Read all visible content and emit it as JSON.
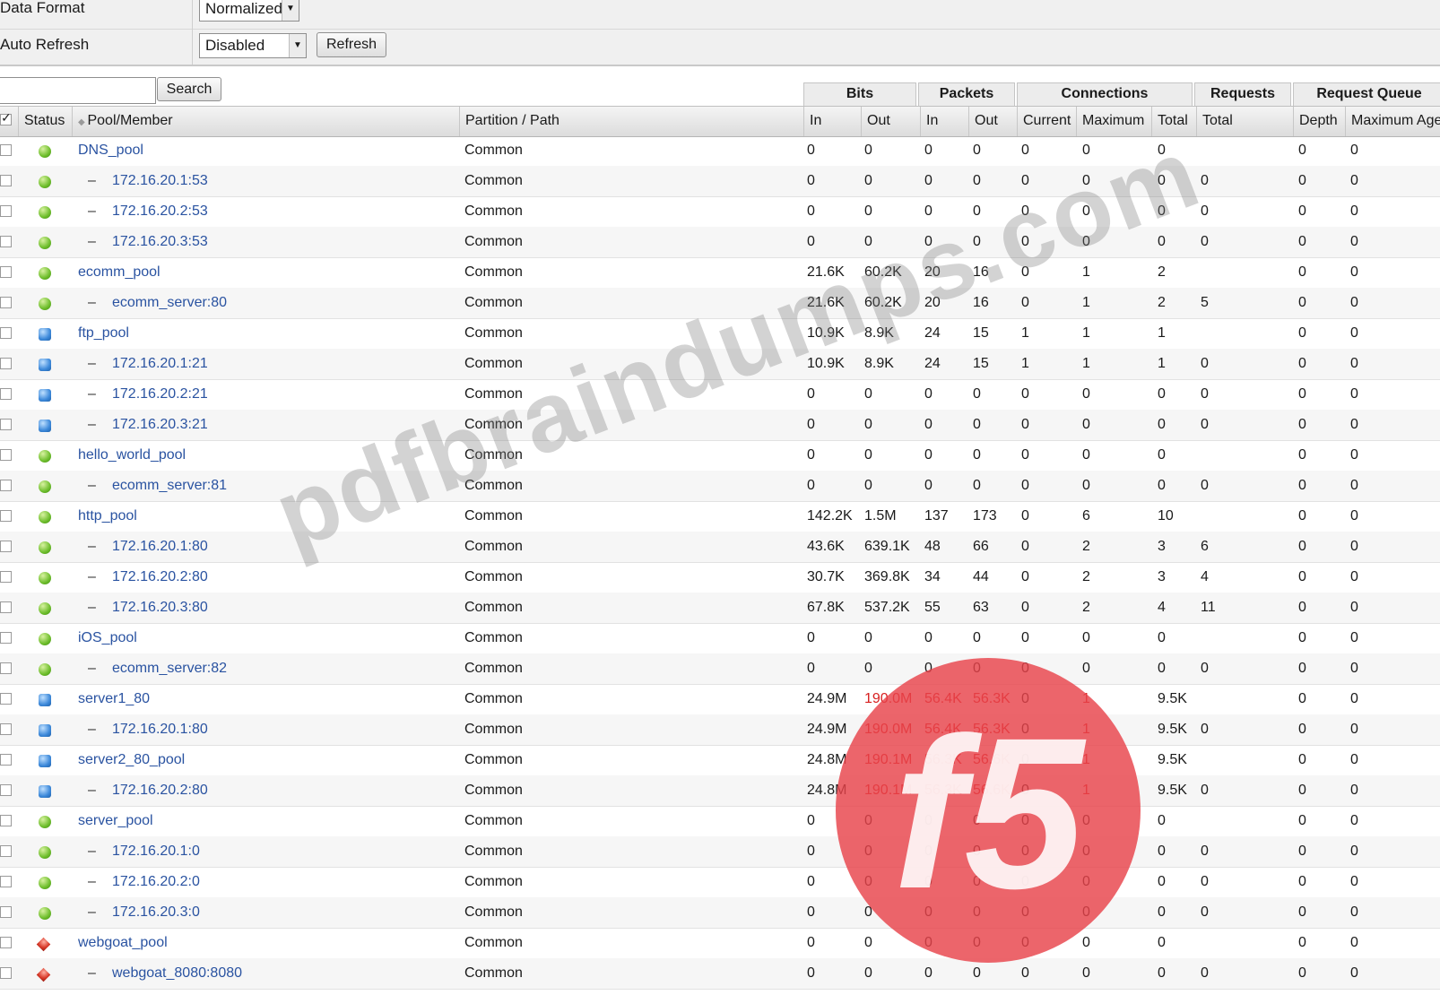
{
  "settings": {
    "data_format_label": "Data Format",
    "data_format_value": "Normalized",
    "auto_refresh_label": "Auto Refresh",
    "auto_refresh_value": "Disabled",
    "refresh_button": "Refresh"
  },
  "search": {
    "button": "Search",
    "value": ""
  },
  "groups": {
    "bits": "Bits",
    "packets": "Packets",
    "connections": "Connections",
    "requests": "Requests",
    "request_queue": "Request Queue"
  },
  "columns": {
    "status": "Status",
    "pool_member": "Pool/Member",
    "partition": "Partition / Path",
    "bits_in": "In",
    "bits_out": "Out",
    "pkts_in": "In",
    "pkts_out": "Out",
    "conn_current": "Current",
    "conn_max": "Maximum",
    "conn_total": "Total",
    "req_total": "Total",
    "rq_depth": "Depth",
    "rq_max_age": "Maximum Age"
  },
  "rows": [
    {
      "name": "DNS_pool",
      "member": false,
      "status": "green",
      "partition": "Common",
      "bin": "0",
      "bout": "0",
      "pin": "0",
      "pout": "0",
      "cur": "0",
      "max": "0",
      "total": "0",
      "req": "",
      "depth": "0",
      "age": "0"
    },
    {
      "name": "172.16.20.1:53",
      "member": true,
      "status": "green",
      "partition": "Common",
      "bin": "0",
      "bout": "0",
      "pin": "0",
      "pout": "0",
      "cur": "0",
      "max": "0",
      "total": "0",
      "req": "0",
      "depth": "0",
      "age": "0"
    },
    {
      "name": "172.16.20.2:53",
      "member": true,
      "status": "green",
      "partition": "Common",
      "bin": "0",
      "bout": "0",
      "pin": "0",
      "pout": "0",
      "cur": "0",
      "max": "0",
      "total": "0",
      "req": "0",
      "depth": "0",
      "age": "0"
    },
    {
      "name": "172.16.20.3:53",
      "member": true,
      "status": "green",
      "partition": "Common",
      "bin": "0",
      "bout": "0",
      "pin": "0",
      "pout": "0",
      "cur": "0",
      "max": "0",
      "total": "0",
      "req": "0",
      "depth": "0",
      "age": "0"
    },
    {
      "name": "ecomm_pool",
      "member": false,
      "status": "green",
      "partition": "Common",
      "bin": "21.6K",
      "bout": "60.2K",
      "pin": "20",
      "pout": "16",
      "cur": "0",
      "max": "1",
      "total": "2",
      "req": "",
      "depth": "0",
      "age": "0"
    },
    {
      "name": "ecomm_server:80",
      "member": true,
      "status": "green",
      "partition": "Common",
      "bin": "21.6K",
      "bout": "60.2K",
      "pin": "20",
      "pout": "16",
      "cur": "0",
      "max": "1",
      "total": "2",
      "req": "5",
      "depth": "0",
      "age": "0"
    },
    {
      "name": "ftp_pool",
      "member": false,
      "status": "blue",
      "partition": "Common",
      "bin": "10.9K",
      "bout": "8.9K",
      "pin": "24",
      "pout": "15",
      "cur": "1",
      "max": "1",
      "total": "1",
      "req": "",
      "depth": "0",
      "age": "0"
    },
    {
      "name": "172.16.20.1:21",
      "member": true,
      "status": "blue",
      "partition": "Common",
      "bin": "10.9K",
      "bout": "8.9K",
      "pin": "24",
      "pout": "15",
      "cur": "1",
      "max": "1",
      "total": "1",
      "req": "0",
      "depth": "0",
      "age": "0"
    },
    {
      "name": "172.16.20.2:21",
      "member": true,
      "status": "blue",
      "partition": "Common",
      "bin": "0",
      "bout": "0",
      "pin": "0",
      "pout": "0",
      "cur": "0",
      "max": "0",
      "total": "0",
      "req": "0",
      "depth": "0",
      "age": "0"
    },
    {
      "name": "172.16.20.3:21",
      "member": true,
      "status": "blue",
      "partition": "Common",
      "bin": "0",
      "bout": "0",
      "pin": "0",
      "pout": "0",
      "cur": "0",
      "max": "0",
      "total": "0",
      "req": "0",
      "depth": "0",
      "age": "0"
    },
    {
      "name": "hello_world_pool",
      "member": false,
      "status": "green",
      "partition": "Common",
      "bin": "0",
      "bout": "0",
      "pin": "0",
      "pout": "0",
      "cur": "0",
      "max": "0",
      "total": "0",
      "req": "",
      "depth": "0",
      "age": "0"
    },
    {
      "name": "ecomm_server:81",
      "member": true,
      "status": "green",
      "partition": "Common",
      "bin": "0",
      "bout": "0",
      "pin": "0",
      "pout": "0",
      "cur": "0",
      "max": "0",
      "total": "0",
      "req": "0",
      "depth": "0",
      "age": "0"
    },
    {
      "name": "http_pool",
      "member": false,
      "status": "green",
      "partition": "Common",
      "bin": "142.2K",
      "bout": "1.5M",
      "pin": "137",
      "pout": "173",
      "cur": "0",
      "max": "6",
      "total": "10",
      "req": "",
      "depth": "0",
      "age": "0"
    },
    {
      "name": "172.16.20.1:80",
      "member": true,
      "status": "green",
      "partition": "Common",
      "bin": "43.6K",
      "bout": "639.1K",
      "pin": "48",
      "pout": "66",
      "cur": "0",
      "max": "2",
      "total": "3",
      "req": "6",
      "depth": "0",
      "age": "0"
    },
    {
      "name": "172.16.20.2:80",
      "member": true,
      "status": "green",
      "partition": "Common",
      "bin": "30.7K",
      "bout": "369.8K",
      "pin": "34",
      "pout": "44",
      "cur": "0",
      "max": "2",
      "total": "3",
      "req": "4",
      "depth": "0",
      "age": "0"
    },
    {
      "name": "172.16.20.3:80",
      "member": true,
      "status": "green",
      "partition": "Common",
      "bin": "67.8K",
      "bout": "537.2K",
      "pin": "55",
      "pout": "63",
      "cur": "0",
      "max": "2",
      "total": "4",
      "req": "11",
      "depth": "0",
      "age": "0"
    },
    {
      "name": "iOS_pool",
      "member": false,
      "status": "green",
      "partition": "Common",
      "bin": "0",
      "bout": "0",
      "pin": "0",
      "pout": "0",
      "cur": "0",
      "max": "0",
      "total": "0",
      "req": "",
      "depth": "0",
      "age": "0"
    },
    {
      "name": "ecomm_server:82",
      "member": true,
      "status": "green",
      "partition": "Common",
      "bin": "0",
      "bout": "0",
      "pin": "0",
      "pout": "0",
      "cur": "0",
      "max": "0",
      "total": "0",
      "req": "0",
      "depth": "0",
      "age": "0"
    },
    {
      "name": "server1_80",
      "member": false,
      "status": "blue",
      "partition": "Common",
      "bin": "24.9M",
      "bout": "190.0M",
      "pin": "56.4K",
      "pout": "56.3K",
      "cur": "0",
      "max": "1",
      "total": "9.5K",
      "req": "",
      "depth": "0",
      "age": "0"
    },
    {
      "name": "172.16.20.1:80",
      "member": true,
      "status": "blue",
      "partition": "Common",
      "bin": "24.9M",
      "bout": "190.0M",
      "pin": "56.4K",
      "pout": "56.3K",
      "cur": "0",
      "max": "1",
      "total": "9.5K",
      "req": "0",
      "depth": "0",
      "age": "0"
    },
    {
      "name": "server2_80_pool",
      "member": false,
      "status": "blue",
      "partition": "Common",
      "bin": "24.8M",
      "bout": "190.1M",
      "pin": "56.3K",
      "pout": "56.6K",
      "cur": "0",
      "max": "1",
      "total": "9.5K",
      "req": "",
      "depth": "0",
      "age": "0"
    },
    {
      "name": "172.16.20.2:80",
      "member": true,
      "status": "blue",
      "partition": "Common",
      "bin": "24.8M",
      "bout": "190.1M",
      "pin": "56.3K",
      "pout": "56.6K",
      "cur": "0",
      "max": "1",
      "total": "9.5K",
      "req": "0",
      "depth": "0",
      "age": "0"
    },
    {
      "name": "server_pool",
      "member": false,
      "status": "green",
      "partition": "Common",
      "bin": "0",
      "bout": "0",
      "pin": "0",
      "pout": "0",
      "cur": "0",
      "max": "0",
      "total": "0",
      "req": "",
      "depth": "0",
      "age": "0"
    },
    {
      "name": "172.16.20.1:0",
      "member": true,
      "status": "green",
      "partition": "Common",
      "bin": "0",
      "bout": "0",
      "pin": "0",
      "pout": "0",
      "cur": "0",
      "max": "0",
      "total": "0",
      "req": "0",
      "depth": "0",
      "age": "0"
    },
    {
      "name": "172.16.20.2:0",
      "member": true,
      "status": "green",
      "partition": "Common",
      "bin": "0",
      "bout": "0",
      "pin": "0",
      "pout": "0",
      "cur": "0",
      "max": "0",
      "total": "0",
      "req": "0",
      "depth": "0",
      "age": "0"
    },
    {
      "name": "172.16.20.3:0",
      "member": true,
      "status": "green",
      "partition": "Common",
      "bin": "0",
      "bout": "0",
      "pin": "0",
      "pout": "0",
      "cur": "0",
      "max": "0",
      "total": "0",
      "req": "0",
      "depth": "0",
      "age": "0"
    },
    {
      "name": "webgoat_pool",
      "member": false,
      "status": "red",
      "partition": "Common",
      "bin": "0",
      "bout": "0",
      "pin": "0",
      "pout": "0",
      "cur": "0",
      "max": "0",
      "total": "0",
      "req": "",
      "depth": "0",
      "age": "0"
    },
    {
      "name": "webgoat_8080:8080",
      "member": true,
      "status": "red",
      "partition": "Common",
      "bin": "0",
      "bout": "0",
      "pin": "0",
      "pout": "0",
      "cur": "0",
      "max": "0",
      "total": "0",
      "req": "0",
      "depth": "0",
      "age": "0"
    }
  ],
  "member_dash": "–",
  "watermark": {
    "text": "pdfbraindumps.com",
    "logo_text": "f5",
    "registered": "®"
  },
  "colors": {
    "link": "#2a53a1",
    "alert": "#d71f1f",
    "logo_red": "#e8434b"
  }
}
